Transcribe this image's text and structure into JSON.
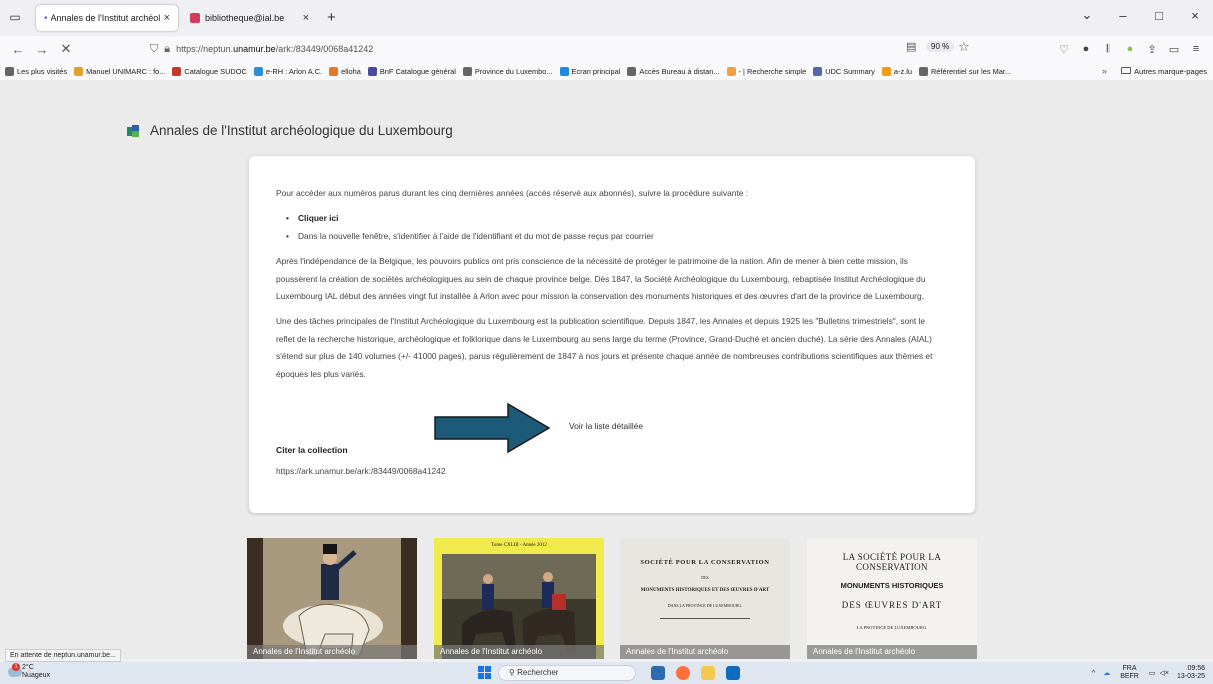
{
  "browser": {
    "tabs": [
      {
        "title": "Annales de l'Institut archéologi",
        "close": "×"
      },
      {
        "title": "bibliotheque@ial.be",
        "close": "×"
      }
    ],
    "new_tab": "+",
    "window_controls": {
      "minimize": "–",
      "maximize": "□",
      "close": "×"
    },
    "nav": {
      "back": "←",
      "forward": "→",
      "stop": "✕"
    },
    "url": {
      "prefix": "https://neptun.",
      "host": "unamur.be",
      "path": "/ark:/83449/0068a41242"
    },
    "zoom": "90 %"
  },
  "bookmarks": [
    {
      "label": "Les plus visités",
      "color": "#666666"
    },
    {
      "label": "Manuel UNIMARC : fo...",
      "color": "#e0a030"
    },
    {
      "label": "Catalogue SUDOC",
      "color": "#c0392b"
    },
    {
      "label": "e-RH : Arlon A.C.",
      "color": "#2a8fd6"
    },
    {
      "label": "elloha",
      "color": "#e37b26"
    },
    {
      "label": "BnF Catalogue général",
      "color": "#4a4a9a"
    },
    {
      "label": "Province du Luxembo...",
      "color": "#666666"
    },
    {
      "label": "Ecran principal",
      "color": "#1e88e5"
    },
    {
      "label": "Accès Bureau à distan...",
      "color": "#666666"
    },
    {
      "label": "- | Recherche simple",
      "color": "#f0a040"
    },
    {
      "label": "UDC Summary",
      "color": "#4e6aa8"
    },
    {
      "label": "a-z.lu",
      "color": "#f39c12"
    },
    {
      "label": "Référentiel sur les Mar...",
      "color": "#666666"
    }
  ],
  "bookmarks_overflow": "»",
  "bookmarks_other": "Autres marque-pages",
  "page": {
    "heading": "Annales de l'Institut archéologique du Luxembourg",
    "intro": "Pour accéder aux numéros parus durant les cinq dernières années (accès réservé aux abonnés), suivre la procédure suivante :",
    "steps": [
      "Cliquer ici",
      "Dans la nouvelle fenêtre, s'identifier à l'aide de l'identifiant et du mot de passe reçus par courrier"
    ],
    "paragraph1": "Après l'indépendance de la Belgique, les pouvoirs publics ont pris conscience de la nécessité de protéger le patrimoine de la nation. Afin de mener à bien cette mission, ils poussèrent la création de sociétés archéologiques au sein de chaque province belge. Dès 1847, la Société Archéologique du Luxembourg, rebaptisée Institut Archéologique du Luxembourg IAL début des années vingt fut installée à Arlon avec pour mission la conservation des monuments historiques et des œuvres d'art de la province de Luxembourg.",
    "paragraph2": "Une des tâches principales de l'Institut Archéologique du Luxembourg est la publication scientifique. Depuis 1847, les Annales et depuis 1925 les \"Bulletins trimestriels\", sont le reflet de la recherche historique, archéologique et folklorique dans le Luxembourg au sens large du terme (Province, Grand-Duché et ancien duché). La série des Annales (AIAL) s'étend sur plus de 140 volumes (+/- 41000 pages), parus régulièrement de 1847 à nos jours et présente chaque année de nombreuses contributions scientifiques aux thèmes et époques les plus variés.",
    "detail_link": "Voir la liste détaillée",
    "cite_title": "Citer la collection",
    "cite_url": "https://ark.unamur.be/ark:/83449/0068a41242"
  },
  "thumbnails": [
    {
      "caption": "Annales de l'Institut archéolo",
      "lines": []
    },
    {
      "caption": "Annales de l'Institut archéolo",
      "lines": [
        "Tome CXLIII - Année 2012"
      ]
    },
    {
      "caption": "Annales de l'Institut archéolo",
      "lines": [
        "SOCIÉTÉ POUR LA CONSERVATION",
        "DES",
        "MONUMENTS HISTORIQUES ET DES ŒUVRES D'ART",
        "DANS LA PROVINCE DE LUXEMBOURG."
      ]
    },
    {
      "caption": "Annales de l'Institut archéolo",
      "lines": [
        "LA SOCIÉTÉ POUR LA CONSERVATION",
        "MONUMENTS HISTORIQUES",
        "DES ŒUVRES D'ART",
        "LA PROVINCE DE LUXEMBOURG."
      ]
    }
  ],
  "status_message": "En attente de neptun.unamur.be...",
  "taskbar": {
    "weather_temp": "2°C",
    "weather_desc": "Nuageux",
    "weather_badge": "1",
    "search_placeholder": "Rechercher",
    "lang_line1": "FRA",
    "lang_line2": "BEFR",
    "time": "09:56",
    "date": "13-03-25"
  },
  "colors": {
    "arrow_fill": "#1d5a7a",
    "arrow_stroke": "#1a1a1a"
  }
}
